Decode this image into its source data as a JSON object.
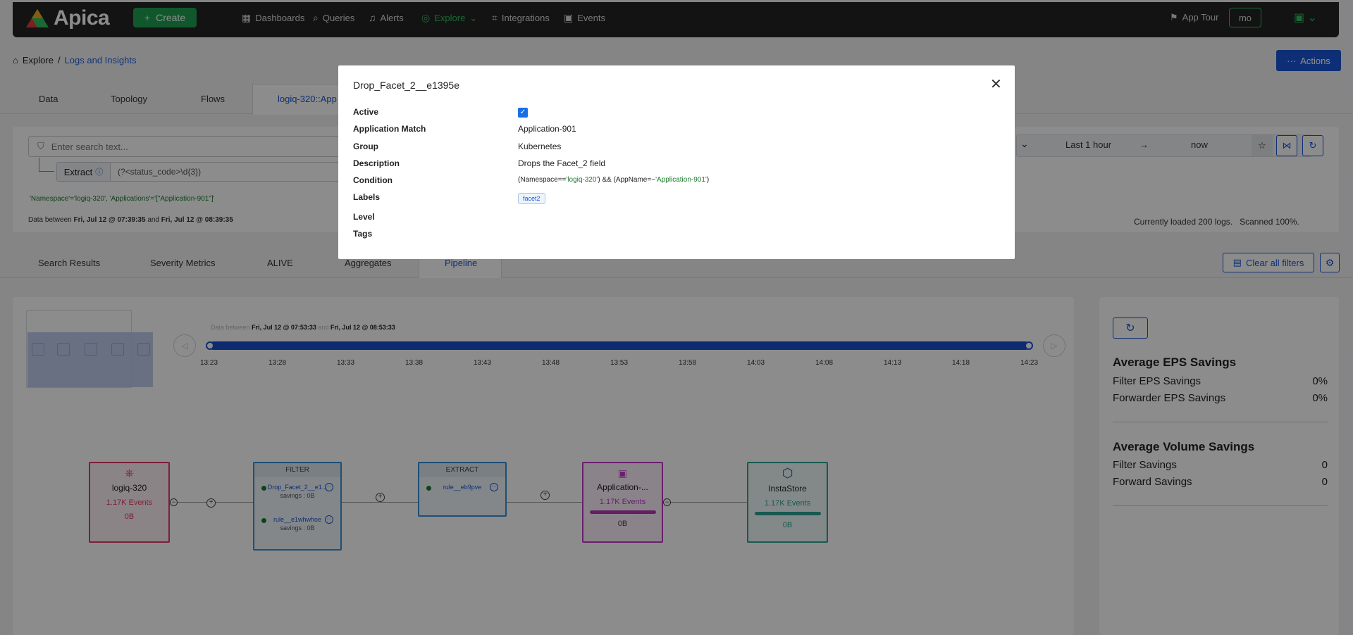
{
  "nav": {
    "logo": "Apica",
    "create": "Create",
    "items": [
      "Dashboards",
      "Queries",
      "Alerts",
      "Explore",
      "Integrations",
      "Events"
    ],
    "app_tour": "App Tour",
    "user": "mo"
  },
  "breadcrumb": {
    "root": "Explore",
    "sep": "/",
    "current": "Logs and Insights"
  },
  "actions": "Actions",
  "tabs": [
    "Data",
    "Topology",
    "Flows",
    "logiq-320::App"
  ],
  "search": {
    "placeholder": "Enter search text...",
    "extract_label": "Extract",
    "extract_value": "(?<status_code>\\d{3})",
    "filter_tags": "'Namespace'='logiq-320', 'Applications'='[\"Application-901\"]'",
    "data_between_prefix": "Data between",
    "start": "Fri, Jul 12 @ 07:39:35",
    "and": "and",
    "end": "Fri, Jul 12 @ 08:39:35",
    "time_from": "Last 1 hour",
    "time_arrow": "→",
    "time_to": "now",
    "loaded": "Currently loaded 200 logs.",
    "scanned": "Scanned 100%."
  },
  "subtabs": [
    "Search Results",
    "Severity Metrics",
    "ALIVE",
    "Aggregates",
    "Pipeline"
  ],
  "clear_filters": "Clear all filters",
  "timeline": {
    "prefix": "Data between",
    "start": "Fri, Jul 12 @ 07:53:33",
    "and": "and",
    "end": "Fri, Jul 12 @ 08:53:33",
    "ticks": [
      "13:23",
      "13:28",
      "13:33",
      "13:38",
      "13:43",
      "13:48",
      "13:53",
      "13:58",
      "14:03",
      "14:08",
      "14:13",
      "14:18",
      "14:23"
    ]
  },
  "pipeline": {
    "source": {
      "name": "logiq-320",
      "events": "1.17K Events",
      "bytes": "0B"
    },
    "filter": {
      "header": "FILTER",
      "rules": [
        {
          "name": "Drop_Facet_2__e1...",
          "savings": "savings : 0B"
        },
        {
          "name": "rule__e1whwhoe",
          "savings": "savings : 0B"
        }
      ]
    },
    "extract": {
      "header": "EXTRACT",
      "rule": "rule__eb9pve"
    },
    "app": {
      "name": "Application-...",
      "events": "1.17K Events",
      "bytes": "0B"
    },
    "store": {
      "name": "InstaStore",
      "events": "1.17K Events",
      "bytes": "0B"
    }
  },
  "stats": {
    "eps_title": "Average EPS Savings",
    "filter_eps_label": "Filter EPS Savings",
    "filter_eps": "0%",
    "forwarder_eps_label": "Forwarder EPS Savings",
    "forwarder_eps": "0%",
    "vol_title": "Average Volume Savings",
    "filter_sav_label": "Filter Savings",
    "filter_sav": "0",
    "forward_sav_label": "Forward Savings",
    "forward_sav": "0"
  },
  "modal": {
    "title": "Drop_Facet_2__e1395e",
    "labels": [
      "Active",
      "Application Match",
      "Group",
      "Description",
      "Condition",
      "Labels",
      "Level",
      "Tags"
    ],
    "app_match": "Application-901",
    "group": "Kubernetes",
    "description": "Drops the Facet_2 field",
    "cond_a": "(Namespace==",
    "cond_b": "'logiq-320'",
    "cond_c": ") && (AppName=~",
    "cond_d": "'Application-901'",
    "cond_e": ")",
    "label_tag": "facet2"
  },
  "colors": {
    "brand_green": "#1e9e4f",
    "primary_blue": "#1a57d6"
  }
}
